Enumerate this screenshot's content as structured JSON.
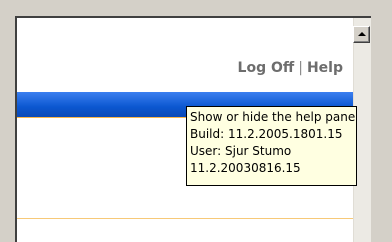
{
  "header": {
    "links": [
      {
        "label": "Log Off"
      },
      {
        "label": "Help"
      }
    ],
    "separator": "|"
  },
  "tooltip": {
    "lines": [
      "Show or hide the help pane",
      "Build: 11.2.2005.1801.15",
      "User: Sjur Stumo",
      "11.2.20030816.15"
    ]
  },
  "colors": {
    "bar": "#0b57d0",
    "accent_line": "#f7b64b",
    "tooltip_bg": "#ffffe1"
  },
  "icons": {
    "scroll_up": "scroll-up-arrow-icon"
  }
}
